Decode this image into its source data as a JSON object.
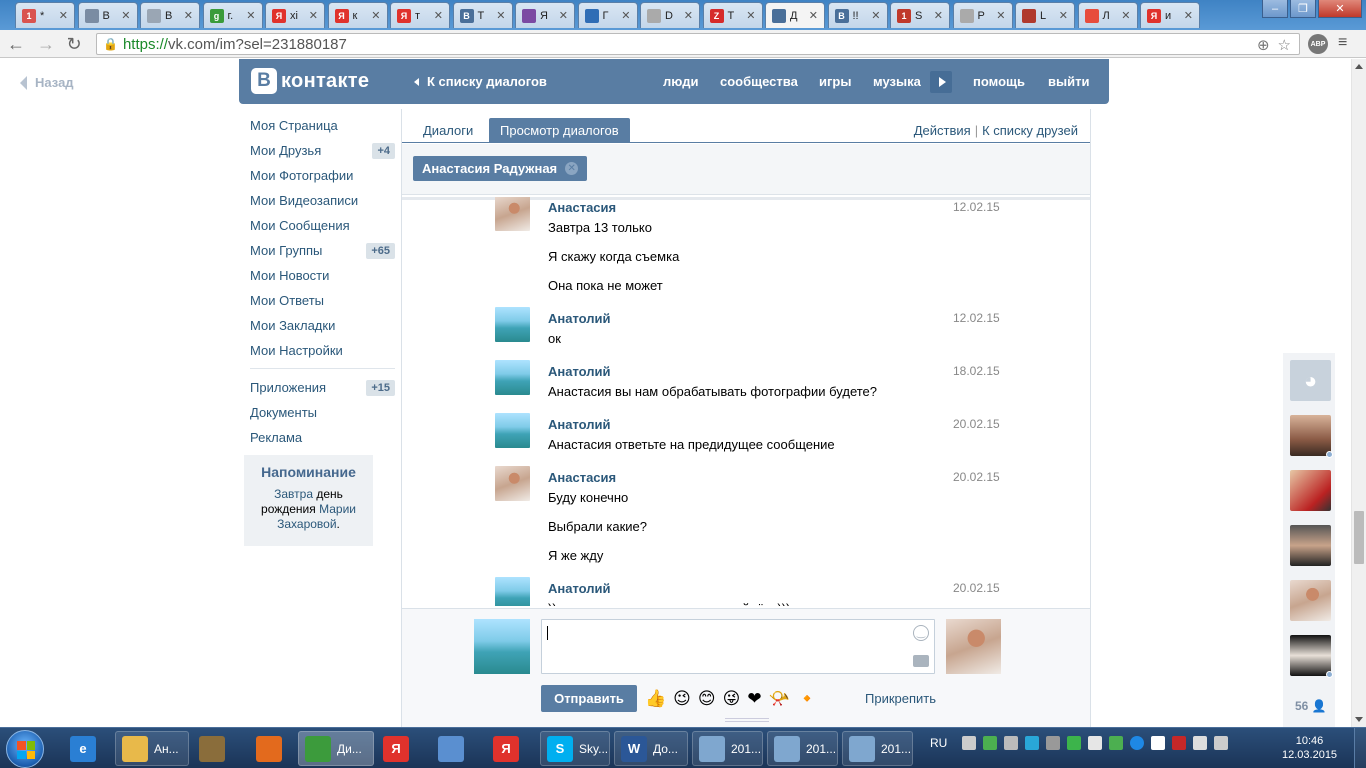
{
  "browser": {
    "tabs": [
      {
        "label": "*",
        "fav_color": "#d9534f",
        "fav_glyph": "1"
      },
      {
        "label": "В",
        "fav_color": "#7a8ca3",
        "fav_glyph": ""
      },
      {
        "label": "В",
        "fav_color": "#9aa6b4",
        "fav_glyph": ""
      },
      {
        "label": "г.",
        "fav_color": "#3a9b3a",
        "fav_glyph": "g"
      },
      {
        "label": "хі",
        "fav_color": "#e0322c",
        "fav_glyph": "Я"
      },
      {
        "label": "к",
        "fav_color": "#e0322c",
        "fav_glyph": "Я"
      },
      {
        "label": "т",
        "fav_color": "#e0322c",
        "fav_glyph": "Я"
      },
      {
        "label": "Т",
        "fav_color": "#4a6f99",
        "fav_glyph": "В"
      },
      {
        "label": "Я",
        "fav_color": "#7b4aa3",
        "fav_glyph": ""
      },
      {
        "label": "Г",
        "fav_color": "#2f6db5",
        "fav_glyph": ""
      },
      {
        "label": "D",
        "fav_color": "#aaa",
        "fav_glyph": ""
      },
      {
        "label": "T",
        "fav_color": "#d62b2b",
        "fav_glyph": "Z"
      },
      {
        "label": "Д",
        "fav_color": "#4a6f99",
        "fav_glyph": "",
        "active": true
      },
      {
        "label": "!!",
        "fav_color": "#4a6f99",
        "fav_glyph": "В"
      },
      {
        "label": "S",
        "fav_color": "#c0392b",
        "fav_glyph": "1"
      },
      {
        "label": "Р",
        "fav_color": "#aaa",
        "fav_glyph": ""
      },
      {
        "label": "L",
        "fav_color": "#b03a2e",
        "fav_glyph": ""
      },
      {
        "label": "Л",
        "fav_color": "#e74c3c",
        "fav_glyph": ""
      },
      {
        "label": "и",
        "fav_color": "#e0322c",
        "fav_glyph": "Я"
      }
    ],
    "url_scheme": "https://",
    "url_rest": "vk.com/im?sel=231880187",
    "abp_label": "ABP"
  },
  "page": {
    "back_label": "Назад",
    "logo_text": "контакте",
    "logo_letter": "В",
    "back_to_dialogs": "К списку диалогов",
    "nav": {
      "people": "люди",
      "communities": "сообщества",
      "games": "игры",
      "music": "музыка",
      "help": "помощь",
      "logout": "выйти"
    },
    "menu": [
      {
        "label": "Моя Страница",
        "badge": ""
      },
      {
        "label": "Мои Друзья",
        "badge": "+4"
      },
      {
        "label": "Мои Фотографии",
        "badge": ""
      },
      {
        "label": "Мои Видеозаписи",
        "badge": ""
      },
      {
        "label": "Мои Сообщения",
        "badge": ""
      },
      {
        "label": "Мои Группы",
        "badge": "+65"
      },
      {
        "label": "Мои Новости",
        "badge": ""
      },
      {
        "label": "Мои Ответы",
        "badge": ""
      },
      {
        "label": "Мои Закладки",
        "badge": ""
      },
      {
        "label": "Мои Настройки",
        "badge": ""
      }
    ],
    "menu2": [
      {
        "label": "Приложения",
        "badge": "+15"
      },
      {
        "label": "Документы",
        "badge": ""
      },
      {
        "label": "Реклама",
        "badge": ""
      }
    ],
    "reminder": {
      "title": "Напоминание",
      "link_when": "Завтра",
      "text_mid": " день рождения ",
      "link_who": "Марии Захаровой",
      "text_end": "."
    },
    "tabs": {
      "dialogs": "Диалоги",
      "view_dialogs": "Просмотр диалогов",
      "actions": "Действия",
      "friends_list": "К списку друзей"
    },
    "chip_name": "Анастасия Радужная",
    "messages": [
      {
        "author": "Анастасия",
        "date": "12.02.15",
        "avatar": "girl",
        "lines": [
          "Завтра 13 только",
          "Я скажу когда съемка",
          "Она пока не может"
        ]
      },
      {
        "author": "Анатолий",
        "date": "12.02.15",
        "avatar": "sea",
        "lines": [
          "ок"
        ]
      },
      {
        "author": "Анатолий",
        "date": "18.02.15",
        "avatar": "sea",
        "lines": [
          "Анастасия вы нам обрабатывать фотографии будете?"
        ]
      },
      {
        "author": "Анатолий",
        "date": "20.02.15",
        "avatar": "sea",
        "lines": [
          "Анастасия ответьте на предидущее сообщение"
        ]
      },
      {
        "author": "Анастасия",
        "date": "20.02.15",
        "avatar": "girl",
        "lines": [
          "Буду конечно",
          "Выбрали какие?",
          "Я же жду"
        ]
      },
      {
        "author": "Анатолий",
        "date": "20.02.15",
        "avatar": "sea",
        "lines": [
          ")) в с таким подходом далеко пойдёте)))"
        ]
      }
    ],
    "composer": {
      "send_label": "Отправить",
      "attach_label": "Прикрепить",
      "emojis": [
        "👍",
        "😉",
        "😊",
        "😜",
        "❤",
        "📯",
        "🔸"
      ]
    },
    "rail_count": "56"
  },
  "taskbar": {
    "items": [
      {
        "label": "",
        "glyph": "e",
        "color": "#2a7fd4"
      },
      {
        "label": "Ан...",
        "glyph": "",
        "color": "#e8b94a"
      },
      {
        "label": "",
        "glyph": "",
        "color": "#8a6d3b"
      },
      {
        "label": "",
        "glyph": "",
        "color": "#e36a1d"
      },
      {
        "label": "Ди...",
        "glyph": "",
        "color": "#3c9b3c",
        "active": true
      },
      {
        "label": "",
        "glyph": "Я",
        "color": "#e0322c"
      },
      {
        "label": "",
        "glyph": "",
        "color": "#5a8fd0"
      },
      {
        "label": "",
        "glyph": "Я",
        "color": "#e0322c"
      },
      {
        "label": "Sky...",
        "glyph": "S",
        "color": "#00aff0"
      },
      {
        "label": "До...",
        "glyph": "W",
        "color": "#2b5797"
      },
      {
        "label": "201...",
        "glyph": "",
        "color": "#7fa7cf"
      },
      {
        "label": "201...",
        "glyph": "",
        "color": "#7fa7cf"
      },
      {
        "label": "201...",
        "glyph": "",
        "color": "#7fa7cf"
      }
    ],
    "lang": "RU",
    "time": "10:46",
    "date": "12.03.2015"
  }
}
